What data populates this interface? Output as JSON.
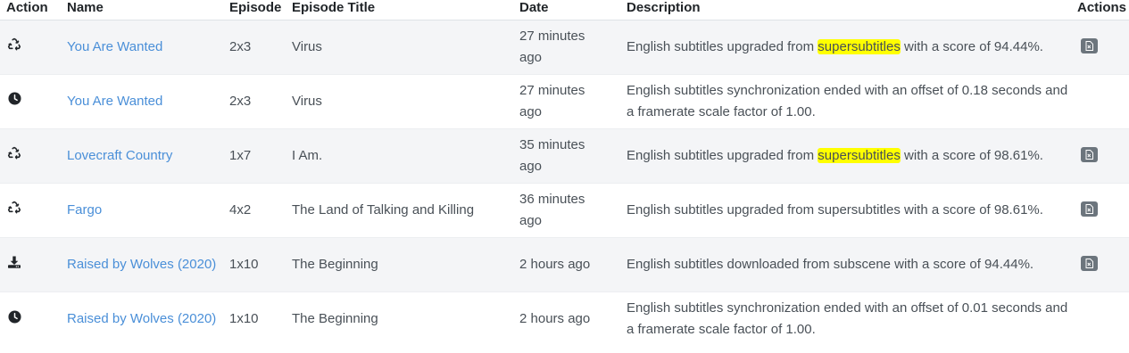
{
  "headers": {
    "action": "Action",
    "name": "Name",
    "episode": "Episode",
    "episode_title": "Episode Title",
    "date": "Date",
    "description": "Description",
    "actions": "Actions"
  },
  "rows": [
    {
      "action_icon": "recycle-icon",
      "name": "You Are Wanted",
      "episode": "2x3",
      "episode_title": "Virus",
      "date": "27 minutes ago",
      "desc_before": "English subtitles upgraded from ",
      "desc_highlight": "supersubtitles",
      "desc_after": " with a score of 94.44%.",
      "has_action_button": true
    },
    {
      "action_icon": "clock-icon",
      "name": "You Are Wanted",
      "episode": "2x3",
      "episode_title": "Virus",
      "date": "27 minutes ago",
      "desc_before": "English subtitles synchronization ended with an offset of 0.18 seconds and a framerate scale factor of 1.00.",
      "desc_highlight": "",
      "desc_after": "",
      "has_action_button": false
    },
    {
      "action_icon": "recycle-icon",
      "name": "Lovecraft Country",
      "episode": "1x7",
      "episode_title": "I Am.",
      "date": "35 minutes ago",
      "desc_before": "English subtitles upgraded from ",
      "desc_highlight": "supersubtitles",
      "desc_after": " with a score of 98.61%.",
      "has_action_button": true
    },
    {
      "action_icon": "recycle-icon",
      "name": "Fargo",
      "episode": "4x2",
      "episode_title": "The Land of Talking and Killing",
      "date": "36 minutes ago",
      "desc_before": "English subtitles upgraded from supersubtitles with a score of 98.61%.",
      "desc_highlight": "",
      "desc_after": "",
      "has_action_button": true
    },
    {
      "action_icon": "download-icon",
      "name": "Raised by Wolves (2020)",
      "episode": "1x10",
      "episode_title": "The Beginning",
      "date": "2 hours ago",
      "desc_before": "English subtitles downloaded from subscene with a score of 94.44%.",
      "desc_highlight": "",
      "desc_after": "",
      "has_action_button": true
    },
    {
      "action_icon": "clock-icon",
      "name": "Raised by Wolves (2020)",
      "episode": "1x10",
      "episode_title": "The Beginning",
      "date": "2 hours ago",
      "desc_before": "English subtitles synchronization ended with an offset of 0.01 seconds and a framerate scale factor of 1.00.",
      "desc_highlight": "",
      "desc_after": "",
      "has_action_button": false
    }
  ],
  "colors": {
    "link": "#4a8fd8",
    "highlight": "#ffff00",
    "button": "#6c757d"
  }
}
